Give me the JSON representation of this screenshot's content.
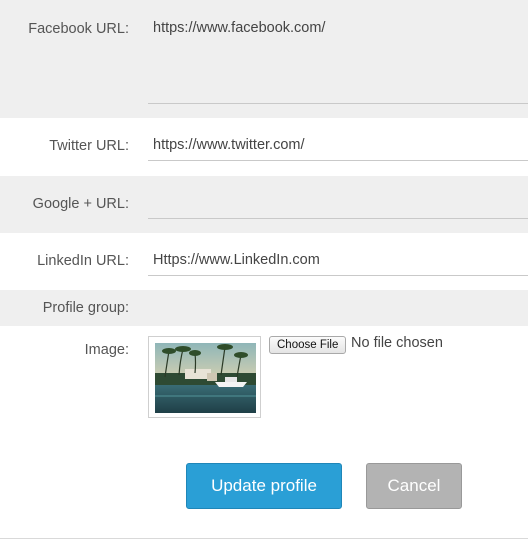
{
  "form": {
    "facebook": {
      "label": "Facebook URL:",
      "value": "https://www.facebook.com/"
    },
    "twitter": {
      "label": "Twitter URL:",
      "value": "https://www.twitter.com/"
    },
    "google": {
      "label": "Google + URL:",
      "value": ""
    },
    "linkedin": {
      "label": "LinkedIn URL:",
      "value": "Https://www.LinkedIn.com"
    },
    "profile_group": {
      "label": "Profile group:"
    },
    "image": {
      "label": "Image:",
      "choose_label": "Choose File",
      "status": "No file chosen"
    }
  },
  "actions": {
    "update_label": "Update profile",
    "cancel_label": "Cancel"
  },
  "colors": {
    "primary": "#2a9fd6",
    "secondary": "#b3b3b3",
    "row_gray": "#efefef"
  }
}
